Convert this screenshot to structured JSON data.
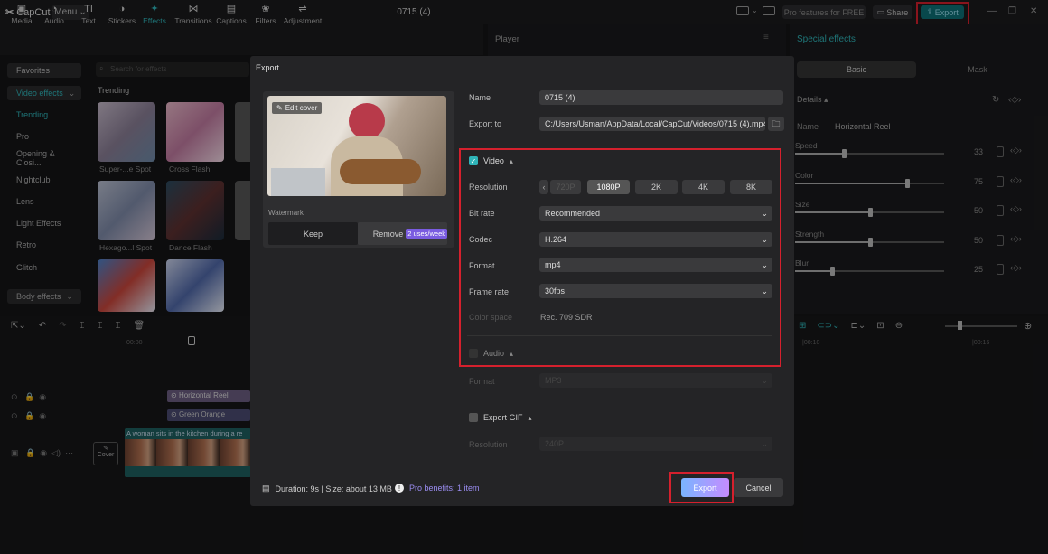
{
  "app": {
    "logo": "CapCut",
    "menu": "Menu",
    "title": "0715 (4)",
    "pro_features": "Pro features for FREE",
    "share": "Share",
    "export": "Export"
  },
  "toolbar": [
    {
      "label": "Media",
      "icon": "▣"
    },
    {
      "label": "Audio",
      "icon": "◔"
    },
    {
      "label": "Text",
      "icon": "TI"
    },
    {
      "label": "Stickers",
      "icon": "◑"
    },
    {
      "label": "Effects",
      "icon": "✦"
    },
    {
      "label": "Transitions",
      "icon": "⋈"
    },
    {
      "label": "Captions",
      "icon": "▤"
    },
    {
      "label": "Filters",
      "icon": "❀"
    },
    {
      "label": "Adjustment",
      "icon": "⇌"
    }
  ],
  "sidebar": {
    "favorites": "Favorites",
    "video_effects": "Video effects",
    "items": [
      "Trending",
      "Pro",
      "Opening & Closi...",
      "Nightclub",
      "Lens",
      "Light Effects",
      "Retro",
      "Glitch"
    ],
    "body_effects": "Body effects"
  },
  "effects": {
    "search_placeholder": "Search for effects",
    "section": "Trending",
    "thumbs": [
      "Super-...e Spot",
      "Cross Flash",
      "Hexago...l Spot",
      "Dance Flash"
    ]
  },
  "player": {
    "title": "Player"
  },
  "right_panel": {
    "title": "Special effects",
    "tab_basic": "Basic",
    "tab_mask": "Mask",
    "details": "Details",
    "name_label": "Name",
    "name_value": "Horizontal Reel",
    "sliders": [
      {
        "label": "Speed",
        "value": "33",
        "level": 0.33
      },
      {
        "label": "Color",
        "value": "75",
        "level": 0.75
      },
      {
        "label": "Size",
        "value": "50",
        "level": 0.5
      },
      {
        "label": "Strength",
        "value": "50",
        "level": 0.5
      },
      {
        "label": "Blur",
        "value": "25",
        "level": 0.25
      }
    ]
  },
  "timeline": {
    "time_start": "00:00",
    "time_mid": "|00:10",
    "time_end": "|00:15",
    "clip_effect1": "Horizontal Reel",
    "clip_effect2": "Green Orange",
    "clip_video": "A woman sits in the kitchen during a re",
    "cover": "Cover"
  },
  "export_dialog": {
    "title": "Export",
    "edit_cover": "Edit cover",
    "watermark": "Watermark",
    "keep": "Keep",
    "remove": "Remove",
    "uses": "2 uses/week",
    "name_label": "Name",
    "name_value": "0715 (4)",
    "export_to_label": "Export to",
    "export_to_value": "C:/Users/Usman/AppData/Local/CapCut/Videos/0715 (4).mp4",
    "video": "Video",
    "resolution_label": "Resolution",
    "resolutions": [
      "720P",
      "1080P",
      "2K",
      "4K",
      "8K"
    ],
    "bitrate_label": "Bit rate",
    "bitrate_value": "Recommended",
    "codec_label": "Codec",
    "codec_value": "H.264",
    "format_label": "Format",
    "format_value": "mp4",
    "framerate_label": "Frame rate",
    "framerate_value": "30fps",
    "colorspace_label": "Color space",
    "colorspace_value": "Rec. 709 SDR",
    "audio": "Audio",
    "audio_format_label": "Format",
    "audio_format_value": "MP3",
    "export_gif": "Export GIF",
    "gif_res_label": "Resolution",
    "gif_res_value": "240P",
    "footer_info": "Duration: 9s | Size: about 13 MB",
    "pro_benefits": "Pro benefits: 1 item",
    "export_btn": "Export",
    "cancel_btn": "Cancel"
  }
}
